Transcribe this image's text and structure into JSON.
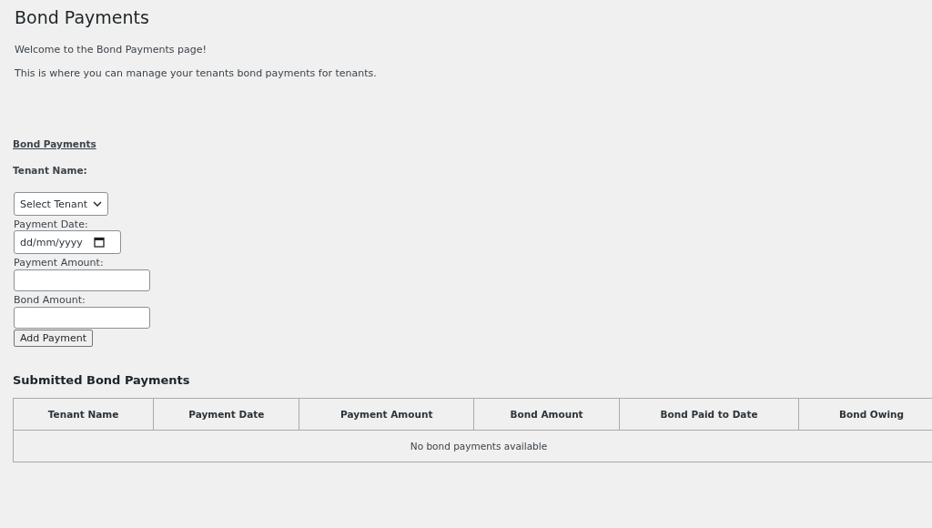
{
  "title": "Bond Payments",
  "intro": [
    "Welcome to the Bond Payments page!",
    "This is where you can manage your tenants bond payments for tenants."
  ],
  "form": {
    "link": "Bond Payments",
    "tenant_label": "Tenant Name:",
    "tenant_select": "Select Tenant",
    "date_label": "Payment Date:",
    "date_placeholder": "dd/mm/yyyy",
    "payment_label": "Payment Amount:",
    "bond_label": "Bond Amount:",
    "submit": "Add Payment"
  },
  "table": {
    "title": "Submitted Bond Payments",
    "columns": [
      "Tenant Name",
      "Payment Date",
      "Payment Amount",
      "Bond Amount",
      "Bond Paid to Date",
      "Bond Owing"
    ],
    "empty": "No bond payments available"
  }
}
